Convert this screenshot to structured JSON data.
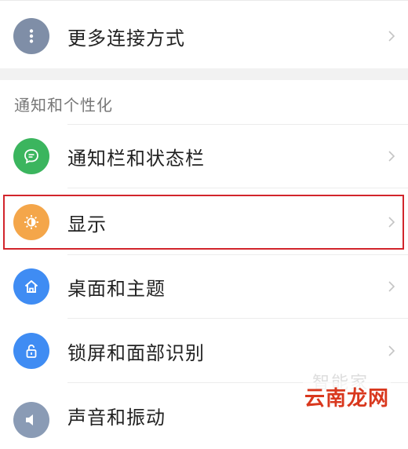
{
  "colors": {
    "more_connect": "#7f8ea7",
    "notification": "#3bb55e",
    "display": "#f4a64a",
    "desktop": "#3f8cf3",
    "lock": "#3f8cf3",
    "sound": "#8a9bb5",
    "highlight_border": "#d2252c",
    "brand": "#d9381e"
  },
  "rows": {
    "more_connect": {
      "label": "更多连接方式",
      "icon": "more-vertical-icon"
    },
    "notification": {
      "label": "通知栏和状态栏",
      "icon": "chat-bubble-icon"
    },
    "display": {
      "label": "显示",
      "icon": "brightness-icon"
    },
    "desktop": {
      "label": "桌面和主题",
      "icon": "home-icon"
    },
    "lock": {
      "label": "锁屏和面部识别",
      "icon": "lock-icon"
    },
    "sound": {
      "label": "声音和振动",
      "icon": "speaker-icon"
    }
  },
  "section": {
    "title": "通知和个性化"
  },
  "watermark": {
    "text": "智能家"
  },
  "brand": {
    "text": "云南龙网"
  }
}
